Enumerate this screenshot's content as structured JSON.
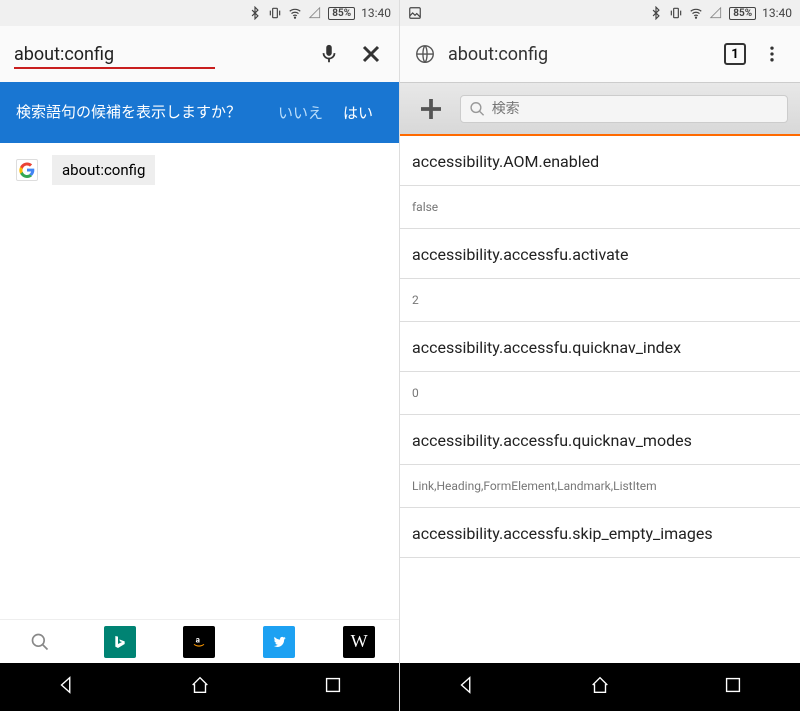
{
  "status": {
    "battery": "85%",
    "time": "13:40"
  },
  "left": {
    "url_value": "about:config",
    "prompt_text": "検索語句の候補を表示しますか？",
    "prompt_no": "いいえ",
    "prompt_yes": "はい",
    "suggestion": "about:config"
  },
  "right": {
    "title": "about:config",
    "tab_count": "1",
    "search_placeholder": "検索",
    "items": [
      {
        "key": "accessibility.AOM.enabled",
        "val": "false"
      },
      {
        "key": "accessibility.accessfu.activate",
        "val": "2"
      },
      {
        "key": "accessibility.accessfu.quicknav_index",
        "val": "0"
      },
      {
        "key": "accessibility.accessfu.quicknav_modes",
        "val": "Link,Heading,FormElement,Landmark,ListItem"
      },
      {
        "key": "accessibility.accessfu.skip_empty_images",
        "val": ""
      }
    ]
  }
}
